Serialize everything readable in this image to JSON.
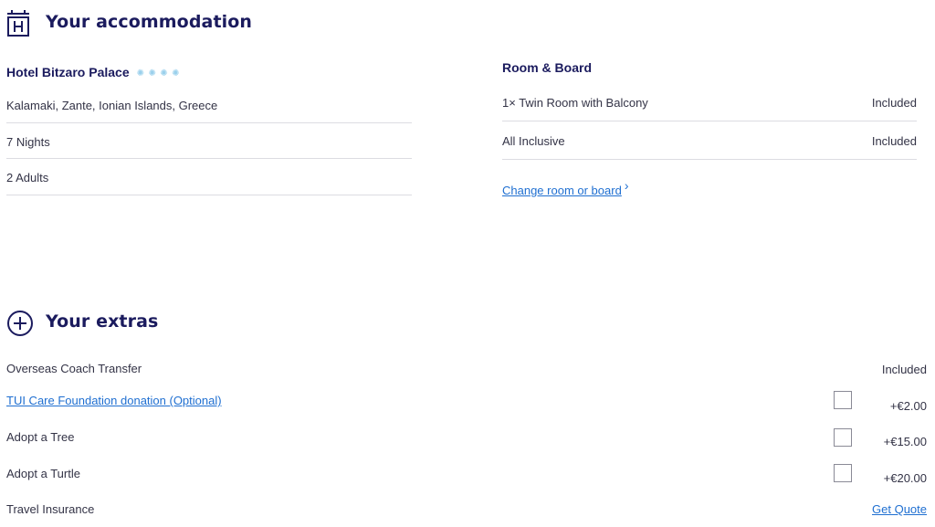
{
  "accommodation": {
    "title": "Your accommodation",
    "hotel_name": "Hotel Bitzaro Palace",
    "rating_stars": 4,
    "location": "Kalamaki, Zante, Ionian Islands, Greece",
    "nights": "7 Nights",
    "guests": "2  Adults"
  },
  "room_board": {
    "title": "Room & Board",
    "items": [
      {
        "label": "1× Twin Room with Balcony",
        "status": "Included"
      },
      {
        "label": "All Inclusive",
        "status": "Included"
      }
    ],
    "change_link": "Change room or board",
    "change_chevron": "›"
  },
  "extras": {
    "title": "Your extras",
    "items": [
      {
        "label": "Overseas Coach Transfer",
        "value": "Included",
        "has_checkbox": false,
        "is_link": false
      },
      {
        "label": "TUI Care Foundation donation (Optional)",
        "value": "+€2.00",
        "has_checkbox": true,
        "is_link": true
      },
      {
        "label": "Adopt a Tree",
        "value": "+€15.00",
        "has_checkbox": true,
        "is_link": false
      },
      {
        "label": "Adopt a Turtle",
        "value": "+€20.00",
        "has_checkbox": true,
        "is_link": false
      },
      {
        "label": "Travel Insurance",
        "value": "Get Quote",
        "has_checkbox": false,
        "is_link": false
      }
    ]
  },
  "colors": {
    "heading": "#1b1b5e",
    "link": "#1f6fd1",
    "star": "#9ad0ec",
    "divider": "#dcdce2"
  }
}
